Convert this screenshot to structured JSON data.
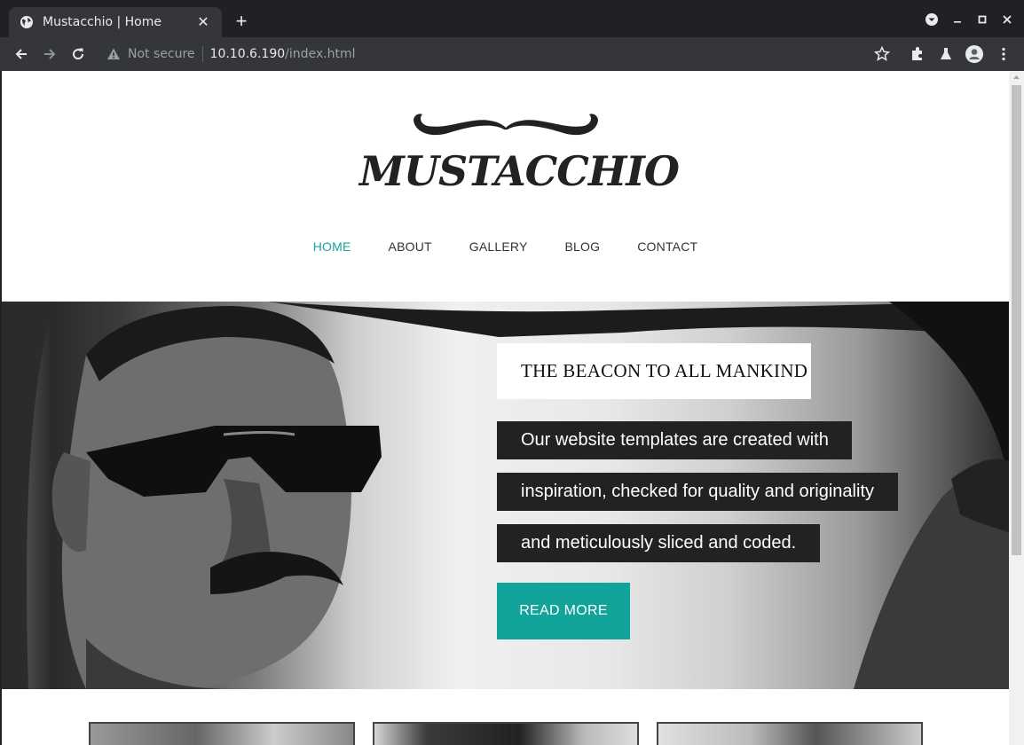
{
  "browser": {
    "tab_title": "Mustacchio | Home",
    "tab_close": "✕",
    "new_tab": "+",
    "security_label": "Not secure",
    "url_host": "10.10.6.190",
    "url_path": "/index.html"
  },
  "site": {
    "logo_text": "MUSTACCHIO",
    "nav": [
      {
        "label": "HOME",
        "active": true
      },
      {
        "label": "ABOUT",
        "active": false
      },
      {
        "label": "GALLERY",
        "active": false
      },
      {
        "label": "BLOG",
        "active": false
      },
      {
        "label": "CONTACT",
        "active": false
      }
    ],
    "hero": {
      "title": "THE BEACON TO ALL MANKIND",
      "lines": [
        "Our website templates are created with",
        "inspiration, checked for quality and originality",
        "and meticulously sliced and coded."
      ],
      "button": "READ MORE"
    }
  },
  "colors": {
    "accent": "#12a39a",
    "nav_active": "#1aa39a",
    "chrome_bg": "#202124",
    "chrome_toolbar": "#35363a"
  }
}
